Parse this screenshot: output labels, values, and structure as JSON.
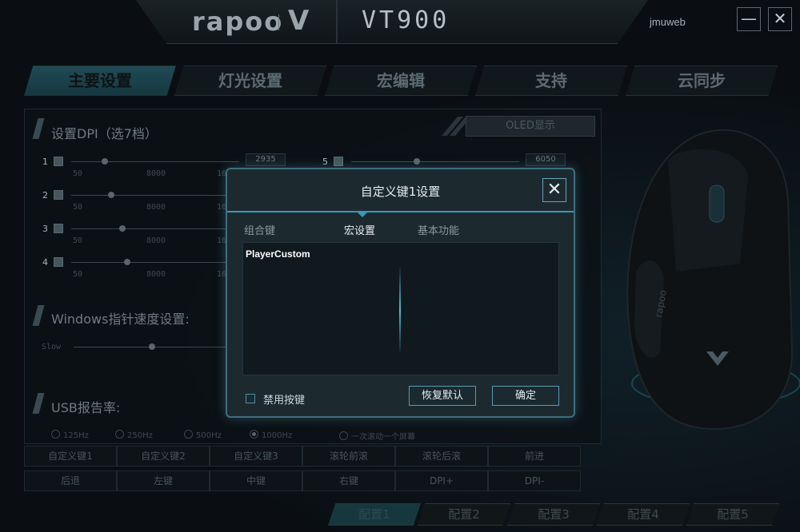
{
  "header": {
    "brand": "rapoo",
    "brand_mark": "V",
    "model": "VT900",
    "username": "jmuweb",
    "minimize_label": "—",
    "close_label": "✕"
  },
  "nav": {
    "tabs": [
      {
        "label": "主要设置",
        "active": true
      },
      {
        "label": "灯光设置",
        "active": false
      },
      {
        "label": "宏编辑",
        "active": false
      },
      {
        "label": "支持",
        "active": false
      },
      {
        "label": "云同步",
        "active": false
      }
    ]
  },
  "main": {
    "dpi_title": "设置DPI（选7档）",
    "oled_button": "OLED显示",
    "dpi_rows": [
      {
        "num": "1",
        "min": "50",
        "mid": "8000",
        "max": "16",
        "value": "2935"
      },
      {
        "num": "2",
        "min": "50",
        "mid": "8000",
        "max": "16",
        "value": ""
      },
      {
        "num": "3",
        "min": "50",
        "mid": "8000",
        "max": "16",
        "value": ""
      },
      {
        "num": "4",
        "min": "50",
        "mid": "8000",
        "max": "16",
        "value": ""
      }
    ],
    "dpi_row5": {
      "num": "5",
      "value": "6050"
    },
    "pointer_title": "Windows指针速度设置:",
    "pointer_slow": "Slow",
    "usb_title": "USB报告率:",
    "usb_rates": [
      "125Hz",
      "250Hz",
      "500Hz",
      "1000Hz"
    ],
    "usb_selected": "1000Hz",
    "scroll_option": "一次滚动一个屏幕",
    "key_buttons_row1": [
      "自定义键1",
      "自定义键2",
      "自定义键3",
      "滚轮前滚",
      "滚轮后滚",
      "前进"
    ],
    "key_buttons_row2": [
      "后退",
      "左键",
      "中键",
      "右键",
      "DPI+",
      "DPI-"
    ]
  },
  "config_tabs": [
    {
      "label": "配置1",
      "active": true
    },
    {
      "label": "配置2",
      "active": false
    },
    {
      "label": "配置3",
      "active": false
    },
    {
      "label": "配置4",
      "active": false
    },
    {
      "label": "配置5",
      "active": false
    }
  ],
  "dialog": {
    "title": "自定义键1设置",
    "close_label": "✕",
    "tabs": [
      {
        "label": "组合键",
        "active": false
      },
      {
        "label": "宏设置",
        "active": true
      },
      {
        "label": "基本功能",
        "active": false
      }
    ],
    "macro_items": [
      "PlayerCustom"
    ],
    "disable_key_label": "禁用按键",
    "restore_button": "恢复默认",
    "ok_button": "确定"
  },
  "colors": {
    "accent": "#3a98b0",
    "background": "#0a0e12",
    "dialog_bg": "#1c2a30"
  }
}
